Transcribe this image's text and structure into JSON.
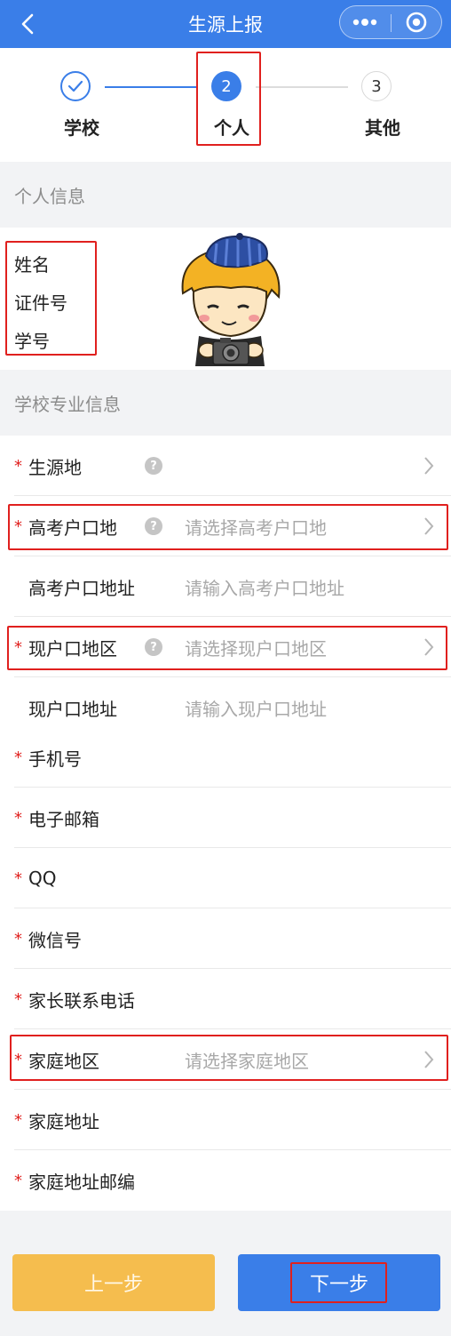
{
  "header": {
    "title": "生源上报",
    "back_icon": "chevron-left-icon",
    "more_icon": "more-dots-icon",
    "close_icon": "target-circle-icon"
  },
  "steps": [
    {
      "number": "✓",
      "label": "学校",
      "state": "done"
    },
    {
      "number": "2",
      "label": "个人",
      "state": "current"
    },
    {
      "number": "3",
      "label": "其他",
      "state": "pending"
    }
  ],
  "sections": {
    "personal": "个人信息",
    "school": "学校专业信息"
  },
  "personal": {
    "name_label": "姓名",
    "id_label": "证件号",
    "student_no_label": "学号"
  },
  "form": {
    "rows": [
      {
        "label": "生源地",
        "required": true,
        "help": true,
        "placeholder": "",
        "arrow": true
      },
      {
        "label": "高考户口地",
        "required": true,
        "help": true,
        "placeholder": "请选择高考户口地",
        "arrow": true
      },
      {
        "label": "高考户口地址",
        "required": false,
        "help": false,
        "placeholder": "请输入高考户口地址",
        "arrow": false
      },
      {
        "label": "现户口地区",
        "required": true,
        "help": true,
        "placeholder": "请选择现户口地区",
        "arrow": true
      },
      {
        "label": "现户口地址",
        "required": false,
        "help": false,
        "placeholder": "请输入现户口地址",
        "arrow": false
      },
      {
        "label": "手机号",
        "required": true,
        "help": false,
        "placeholder": "",
        "arrow": false
      },
      {
        "label": "电子邮箱",
        "required": true,
        "help": false,
        "placeholder": "",
        "arrow": false
      },
      {
        "label": "QQ",
        "required": true,
        "help": false,
        "placeholder": "",
        "arrow": false
      },
      {
        "label": "微信号",
        "required": true,
        "help": false,
        "placeholder": "",
        "arrow": false
      },
      {
        "label": "家长联系电话",
        "required": true,
        "help": false,
        "placeholder": "",
        "arrow": false
      },
      {
        "label": "家庭地区",
        "required": true,
        "help": false,
        "placeholder": "请选择家庭地区",
        "arrow": true
      },
      {
        "label": "家庭地址",
        "required": true,
        "help": false,
        "placeholder": "",
        "arrow": false
      },
      {
        "label": "家庭地址邮编",
        "required": true,
        "help": false,
        "placeholder": "",
        "arrow": false
      }
    ]
  },
  "footer": {
    "prev_label": "上一步",
    "next_label": "下一步"
  },
  "colors": {
    "primary": "#3a7ee8",
    "prev_button": "#f5bd4e",
    "required": "#e0201e",
    "highlight_box": "#e0201e"
  }
}
